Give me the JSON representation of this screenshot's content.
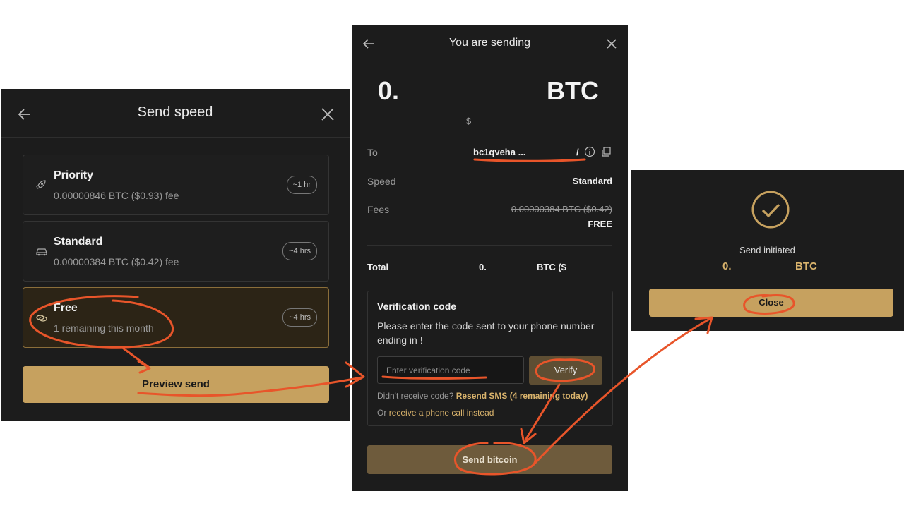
{
  "speed_panel": {
    "title": "Send speed",
    "options": [
      {
        "name": "Priority",
        "detail": "0.00000846 BTC ($0.93) fee",
        "badge": "~1 hr",
        "icon": "rocket-icon",
        "selected": false
      },
      {
        "name": "Standard",
        "detail": "0.00000384 BTC ($0.42) fee",
        "badge": "~4 hrs",
        "icon": "car-icon",
        "selected": false
      },
      {
        "name": "Free",
        "detail": "1 remaining this month",
        "badge": "~4 hrs",
        "icon": "coins-icon",
        "selected": true
      }
    ],
    "preview_button": "Preview send"
  },
  "review_panel": {
    "title": "You are sending",
    "amount_btc_prefix": "0.",
    "amount_btc_unit": "BTC",
    "amount_usd_prefix": "$",
    "to_label": "To",
    "to_value": "bc1qveha ...",
    "to_value_tail": "/",
    "speed_label": "Speed",
    "speed_value": "Standard",
    "fees_label": "Fees",
    "fees_struck": "0.00000384 BTC ($0.42)",
    "fees_value": "FREE",
    "total_label": "Total",
    "total_prefix": "0.",
    "total_unit": "BTC ($",
    "verification": {
      "title": "Verification code",
      "description": "Please enter the code sent to your phone number ending in !",
      "input_placeholder": "Enter verification code",
      "verify_button": "Verify",
      "resend_prefix": "Didn't receive code?",
      "resend_link": "Resend SMS (4 remaining today)",
      "call_prefix": "Or",
      "call_link": "receive a phone call instead"
    },
    "send_button": "Send bitcoin"
  },
  "confirm_panel": {
    "status": "Send initiated",
    "amount_prefix": "0.",
    "amount_unit": "BTC",
    "close_button": "Close"
  },
  "colors": {
    "panel_bg": "#1c1c1c",
    "gold": "#c6a15f",
    "annotation": "#e8552a"
  }
}
